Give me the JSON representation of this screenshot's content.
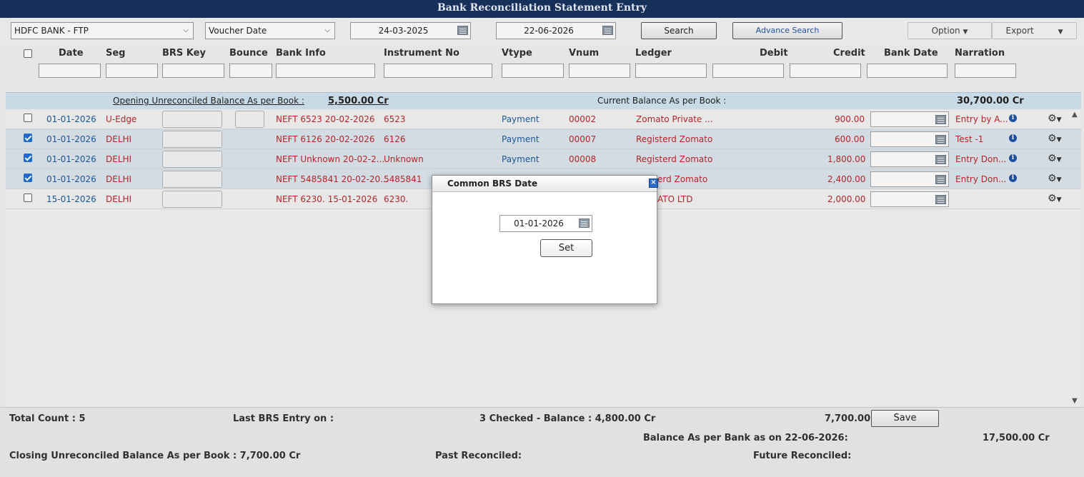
{
  "title": "Bank Reconciliation Statement Entry",
  "toolbar": {
    "bank_select": "HDFC BANK - FTP",
    "date_type_select": "Voucher Date",
    "from_date": "24-03-2025",
    "to_date": "22-06-2026",
    "search_label": "Search",
    "advance_search_label": "Advance Search",
    "option_label": "Option",
    "export_label": "Export"
  },
  "columns": [
    "Date",
    "Seg",
    "BRS Key",
    "Bounce",
    "Bank Info",
    "Instrument No",
    "Vtype",
    "Vnum",
    "Ledger",
    "Debit",
    "Credit",
    "Bank Date",
    "Narration"
  ],
  "balance_bar": {
    "opening_label": "Opening Unreconciled Balance As per Book :",
    "opening_value": "5,500.00 Cr",
    "current_label": "Current Balance As per Book :",
    "current_value": "30,700.00 Cr"
  },
  "rows": [
    {
      "checked": false,
      "date": "01-01-2026",
      "seg": "U-Edge",
      "bank_info": "NEFT 6523 20-02-2026",
      "instrument": "6523",
      "vtype": "Payment",
      "vnum": "00002",
      "ledger": "Zomato Private ...",
      "credit": "900.00",
      "narration": "Entry by A..."
    },
    {
      "checked": true,
      "date": "01-01-2026",
      "seg": "DELHI",
      "bank_info": "NEFT 6126 20-02-2026",
      "instrument": "6126",
      "vtype": "Payment",
      "vnum": "00007",
      "ledger": "Registerd Zomato",
      "credit": "600.00",
      "narration": "Test -1"
    },
    {
      "checked": true,
      "date": "01-01-2026",
      "seg": "DELHI",
      "bank_info": "NEFT Unknown 20-02-2...",
      "instrument": "Unknown",
      "vtype": "Payment",
      "vnum": "00008",
      "ledger": "Registerd Zomato",
      "credit": "1,800.00",
      "narration": "Entry Don..."
    },
    {
      "checked": true,
      "date": "01-01-2026",
      "seg": "DELHI",
      "bank_info": "NEFT 5485841 20-02-20...",
      "instrument": "5485841",
      "vtype": "",
      "vnum": "",
      "ledger": "erd Zomato",
      "credit": "2,400.00",
      "narration": "Entry Don..."
    },
    {
      "checked": false,
      "date": "15-01-2026",
      "seg": "DELHI",
      "bank_info": "NEFT 6230. 15-01-2026",
      "instrument": "6230.",
      "vtype": "",
      "vnum": "",
      "ledger": "ATO LTD",
      "credit": "2,000.00",
      "narration": ""
    }
  ],
  "footer": {
    "total_count": "Total Count : 5",
    "last_brs": "Last BRS Entry on :",
    "checked_balance": "3 Checked - Balance : 4,800.00 Cr",
    "total_value": "7,700.00",
    "save_label": "Save",
    "bank_balance_label": "Balance As per Bank as on 22-06-2026:",
    "bank_balance_value": "17,500.00 Cr",
    "closing_label": "Closing Unreconciled Balance As per Book : 7,700.00 Cr",
    "past_reconciled": "Past Reconciled:",
    "future_reconciled": "Future Reconciled:"
  },
  "modal": {
    "title": "Common BRS Date",
    "date_value": "01-01-2026",
    "set_label": "Set",
    "close_glyph": "×"
  },
  "icons": {
    "calendar": "calendar-icon",
    "info": "info-icon",
    "gear": "gear-icon",
    "close": "close-icon"
  },
  "colors": {
    "titlebar": "#17305a",
    "text_blue": "#1c5a9e",
    "text_red": "#c0262a",
    "balance_bar": "#d3e4f2",
    "selected_row": "#dde6ee"
  }
}
